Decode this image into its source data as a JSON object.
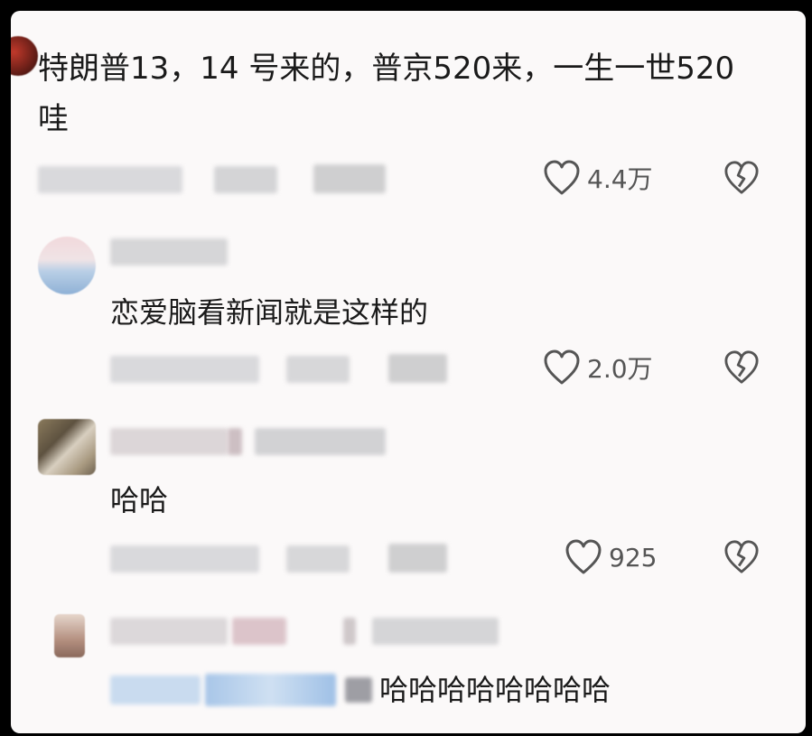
{
  "comments": [
    {
      "text": "特朗普13，14 号来的，普京520来，一生一世520哇",
      "likes": "4.4万"
    },
    {
      "text": "恋爱脑看新闻就是这样的",
      "likes": "2.0万"
    },
    {
      "text": "哈哈",
      "likes": "925"
    },
    {
      "text": "哈哈哈哈哈哈哈哈"
    }
  ],
  "icons": {
    "like": "heart-outline-icon",
    "dislike": "broken-heart-icon"
  },
  "colors": {
    "background": "#fbf9f9",
    "text": "#1a1a1a",
    "icon": "#555555"
  }
}
